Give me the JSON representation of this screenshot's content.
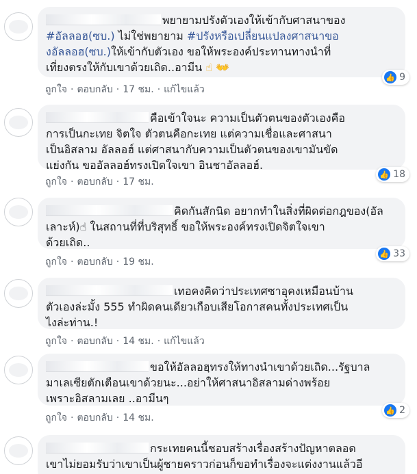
{
  "comments": [
    {
      "lines": [
        {
          "text": "พยายามปรังตัวเองให้เข้ากับศาสนาของ"
        },
        {
          "text": "#อัลลอฮ(ซบ.) ไม่ใช่พยายาม #ปรังหรือเปลี่ยนแปลงศาสนาขอ"
        },
        {
          "text": "งอัลลอฮ(ซบ.)ให้เข้ากับตัวเอง ขอให้พระองค์ประทานทางนำที่"
        },
        {
          "text": "เที่ยงตรงให้กับเขาด้วยเถิด..อามีน"
        }
      ],
      "tags": [
        "#อัลลอฮ(ซบ.)",
        "#ปรังหรือเปลี่ยนแปลงศาสนาขอ",
        "งอัลลอฮ(ซบ.)"
      ],
      "emoji_after": "☝ 👐",
      "like_count": "9",
      "actions": [
        "ถูกใจ",
        "ตอบกลับ",
        "17 ชม.",
        "แก้ไขแล้ว"
      ]
    },
    {
      "lines": [
        {
          "text": "คือเข้าใจนะ ความเป็นตัวตนของตัวเองคือ"
        },
        {
          "text": "การเป็นกะเทย จิตใจ ตัวตนคือกะเทย แต่ความเชื่อและศาสนา"
        },
        {
          "text": "เป็นอิสลาม อัลลอฮ์ แต่ศาสนากับความเป็นตัวตนของเขามันขัด"
        },
        {
          "text": "แย่งกัน ขออัลลอฮ์ทรงเปิดใจเขา อินชาอัลลอฮ์."
        }
      ],
      "like_count": "18",
      "actions": [
        "ถูกใจ",
        "ตอบกลับ",
        "17 ชม."
      ]
    },
    {
      "lines": [
        {
          "text": "คิดกันสักนิด อยากทำในสิ่งที่ผิดต่อกฎของ(อัล"
        },
        {
          "text": "เลาะห์)☝ ในสถานที่ที่บริสุทธิ์ ขอให้พระองค์ทรงเปิดจิตใจเขา"
        },
        {
          "text": "ด้วยเถิด.."
        }
      ],
      "like_count": "33",
      "actions": [
        "ถูกใจ",
        "ตอบกลับ",
        "19 ชม."
      ]
    },
    {
      "lines": [
        {
          "text": "เทอคงคิดว่าประเทศซาอุคงเหมือนบ้าน"
        },
        {
          "text": "ตัวเองล่ะมั้ง 555 ทำผิดคนเดียวเกือบเสียโอกาสคนทั้งประเทศเป็น"
        },
        {
          "text": "ไงล่ะท่าน.!"
        }
      ],
      "actions": [
        "ถูกใจ",
        "ตอบกลับ",
        "14 ชม.",
        "แก้ไขแล้ว"
      ]
    },
    {
      "lines": [
        {
          "text": "ขอให้อัลลอฮฺทรงให้ทางนำเขาด้วยเถิด...รัฐบาล"
        },
        {
          "text": "มาเลเซียตักเตือนเขาด้วยนะ...อย่าให้ศาสนาอิสลามด่างพร้อย"
        },
        {
          "text": "เพราะอิสลามเลย ..อามีนๆ"
        }
      ],
      "like_count": "2",
      "actions": [
        "ถูกใจ",
        "ตอบกลับ",
        "14 ชม."
      ]
    },
    {
      "lines": [
        {
          "text": "กระเทยคนนี้ชอบสร้างเรื่องสร้างปัญหาตลอด"
        },
        {
          "text": "เขาไม่ยอมรับว่าเขาเป็นผู้ชายคราวก่อนก็ขอทำเรื่องจะแต่งงานแล้วอี"
        }
      ]
    }
  ],
  "icons": {
    "like": "thumbs-up-icon"
  },
  "colors": {
    "bubble": "#f2f3f5",
    "link": "#385898",
    "like": "#1877f2",
    "meta": "#606770"
  }
}
